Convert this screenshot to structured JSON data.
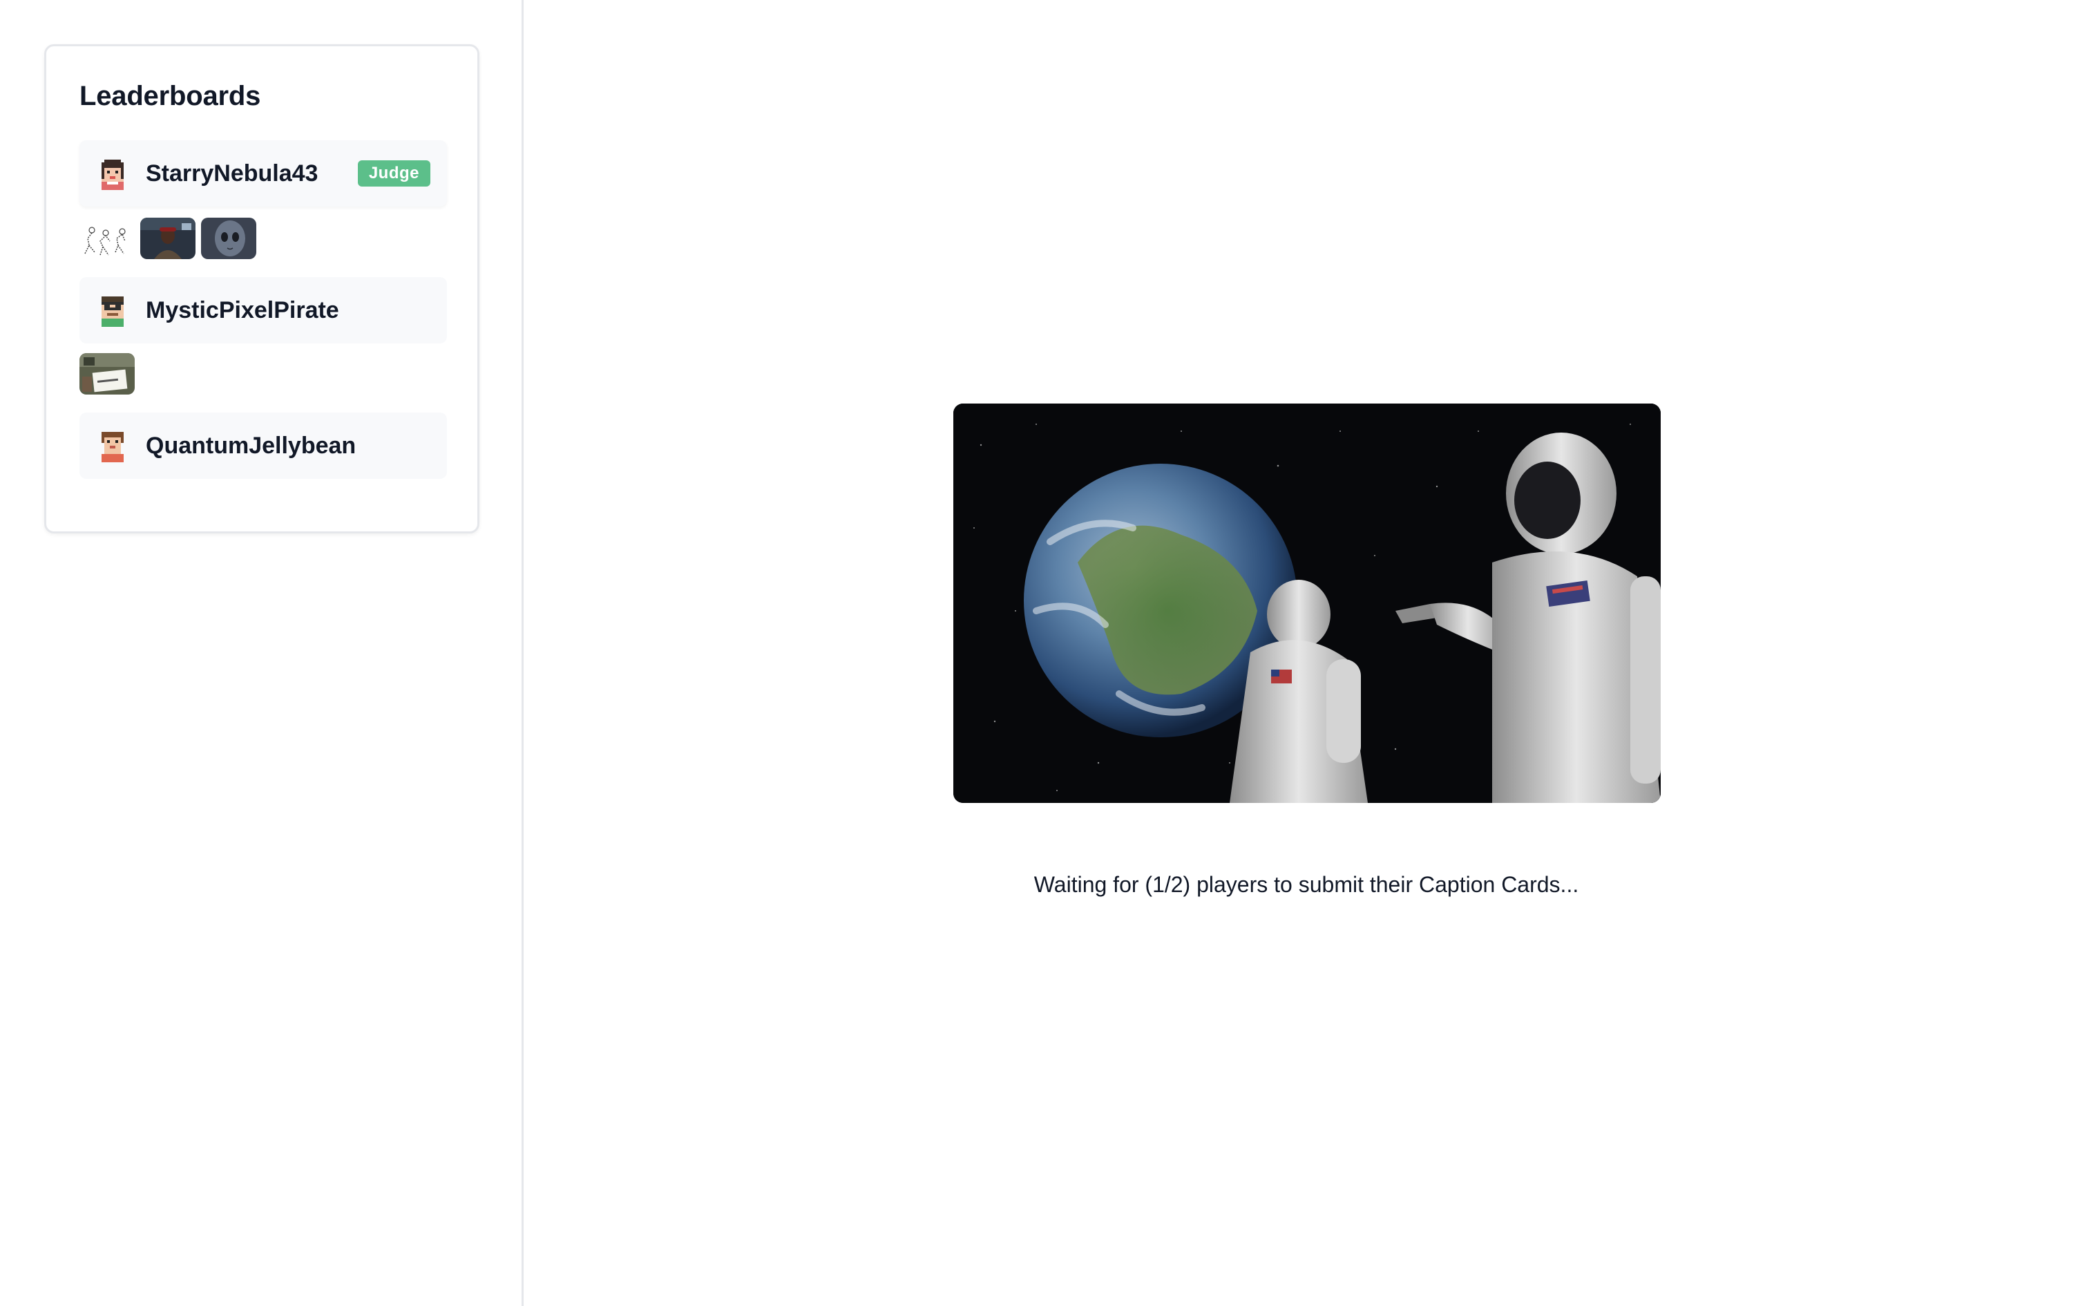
{
  "leaderboard": {
    "title": "Leaderboards",
    "players": [
      {
        "name": "StarryNebula43",
        "badge": "Judge",
        "avatar_icon": "pixel-girl-avatar-icon",
        "cards": [
          "sketch-thumbnail",
          "dark-scene-thumbnail",
          "alien-thumbnail"
        ]
      },
      {
        "name": "MysticPixelPirate",
        "avatar_icon": "pixel-pirate-avatar-icon",
        "cards": [
          "sign-photo-thumbnail"
        ]
      },
      {
        "name": "QuantumJellybean",
        "avatar_icon": "pixel-boy-avatar-icon",
        "cards": []
      }
    ]
  },
  "game": {
    "prompt_image": "astronauts-earth-meme",
    "status_text": "Waiting for (1/2) players to submit their Caption Cards..."
  },
  "colors": {
    "judge_badge": "#5cbf8a",
    "row_background": "#f8f9fb",
    "border": "#e5e7eb",
    "text": "#111827"
  }
}
